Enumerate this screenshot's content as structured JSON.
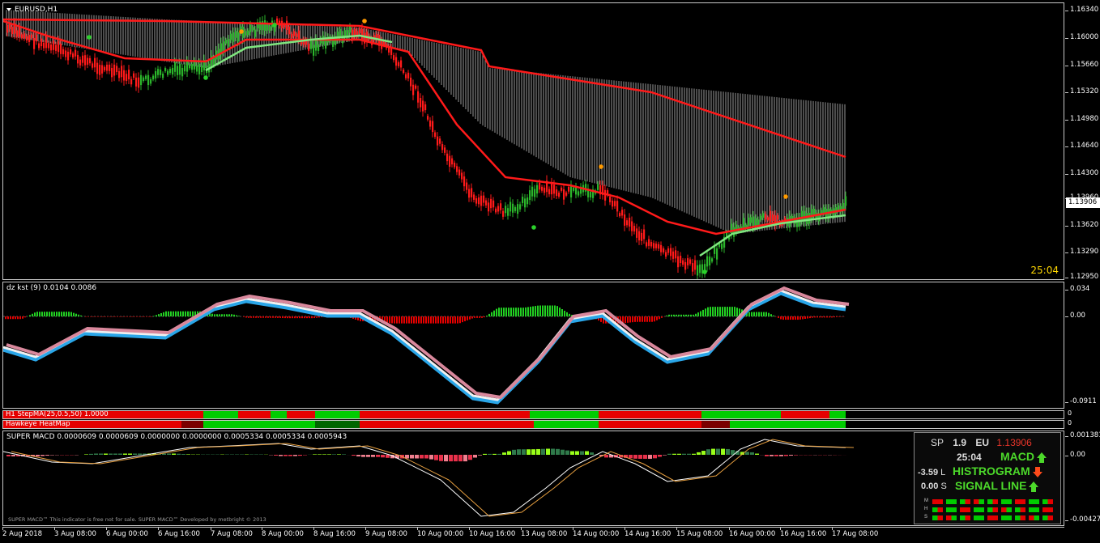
{
  "main_chart": {
    "symbol": "EURUSD,H1",
    "timer": "25:04",
    "current_price": "1.13906",
    "price_ticks": [
      "1.16340",
      "1.16000",
      "1.15660",
      "1.15320",
      "1.14980",
      "1.14640",
      "1.14300",
      "1.13960",
      "1.13620",
      "1.13290",
      "1.12950"
    ]
  },
  "kst_panel": {
    "label": "dz kst (9) 0.0104 0.0086",
    "ticks": [
      "0.034",
      "0.00",
      "-0.0911"
    ]
  },
  "stepma_strip": {
    "label": "H1 StepMA(25,0.5,50) 1.0000",
    "close": "0"
  },
  "heatmap_strip": {
    "label": "Hawkeye HeatMap",
    "close": "0"
  },
  "macd_panel": {
    "label": "SUPER MACD 0.0000609 0.0000609 0.0000000 0.0000000 0.0005334 0.0005334 0.0005943",
    "ticks": [
      "0.001381",
      "0.00",
      "-0.004277"
    ],
    "disclaimer": "SUPER MACD™ This indicator is free not for sale. SUPER MACD™ Developed by metbright © 2013"
  },
  "dashboard": {
    "sp_label": "SP",
    "sp_value": "1.9",
    "pair": "EU",
    "price": "1.13906",
    "timer": "25:04",
    "macd_label": "MACD",
    "macd_dir": "up",
    "hist_label": "HISTROGRAM",
    "hist_dir": "down",
    "signal_label": "SIGNAL LINE",
    "signal_dir": "up",
    "l_value": "-3.59",
    "l_label": "L",
    "s_value": "0.00",
    "s_label": "S",
    "grid_rows": [
      "M",
      "H",
      "S"
    ],
    "colors": {
      "up": "#4cd92a",
      "down": "#ff4a1a",
      "price": "#e8352a"
    }
  },
  "time_axis": [
    "2 Aug 2018",
    "3 Aug 08:00",
    "6 Aug 00:00",
    "6 Aug 16:00",
    "7 Aug 08:00",
    "8 Aug 00:00",
    "8 Aug 16:00",
    "9 Aug 08:00",
    "10 Aug 00:00",
    "10 Aug 16:00",
    "13 Aug 08:00",
    "14 Aug 00:00",
    "14 Aug 16:00",
    "15 Aug 08:00",
    "16 Aug 00:00",
    "16 Aug 16:00",
    "17 Aug 08:00"
  ]
}
